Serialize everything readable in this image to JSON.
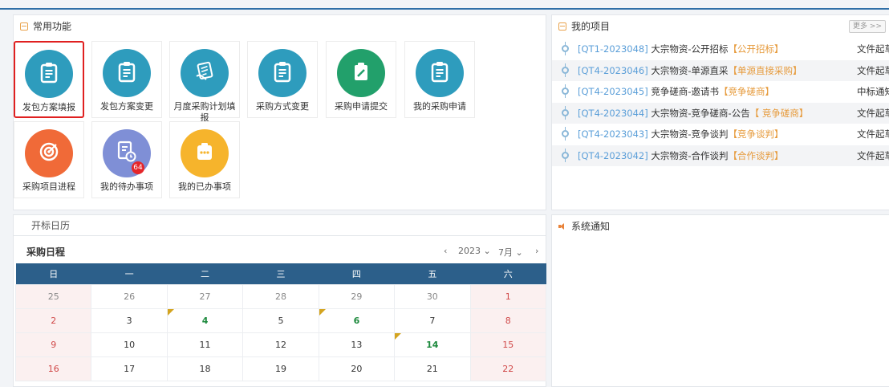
{
  "common": {
    "title": "常用功能",
    "items": [
      {
        "label": "发包方案填报",
        "color": "#2e9cbd",
        "icon": "clipboard-icon",
        "selected": true
      },
      {
        "label": "发包方案变更",
        "color": "#2e9cbd",
        "icon": "clipboard-icon"
      },
      {
        "label": "月度采购计划填报",
        "color": "#2e9cbd",
        "icon": "hand-document-icon"
      },
      {
        "label": "采购方式变更",
        "color": "#2e9cbd",
        "icon": "clipboard-icon"
      },
      {
        "label": "采购申请提交",
        "color": "#22a06b",
        "icon": "clipboard-pen-icon"
      },
      {
        "label": "我的采购申请",
        "color": "#2e9cbd",
        "icon": "clipboard-icon"
      },
      {
        "label": "采购项目进程",
        "color": "#f06a38",
        "icon": "target-icon"
      },
      {
        "label": "我的待办事项",
        "color": "#7f8fd6",
        "icon": "document-clock-icon",
        "badge": "64"
      },
      {
        "label": "我的已办事项",
        "color": "#f6b42c",
        "icon": "clipboard-dots-icon"
      }
    ]
  },
  "projects": {
    "title": "我的项目",
    "more_label": "更多 >>",
    "rows": [
      {
        "code": "[QT1-2023048]",
        "title": "大宗物资-公开招标",
        "tag": "【公开招标】",
        "status": "文件起草"
      },
      {
        "code": "[QT4-2023046]",
        "title": "大宗物资-单源直采",
        "tag": "【单源直接采购】",
        "status": "文件起草"
      },
      {
        "code": "[QT4-2023045]",
        "title": "竞争磋商-邀请书",
        "tag": "【竞争磋商】",
        "status": "中标通知"
      },
      {
        "code": "[QT4-2023044]",
        "title": "大宗物资-竞争磋商-公告",
        "tag": "【 竞争磋商】",
        "status": "文件起草"
      },
      {
        "code": "[QT4-2023043]",
        "title": "大宗物资-竞争谈判",
        "tag": "【竞争谈判】",
        "status": "文件起草"
      },
      {
        "code": "[QT4-2023042]",
        "title": "大宗物资-合作谈判",
        "tag": "【合作谈判】",
        "status": "文件起草"
      }
    ]
  },
  "calendar": {
    "panel_title": "开标日历",
    "title": "采购日程",
    "prev_label": "‹",
    "next_label": "›",
    "year": "2023",
    "month": "7月",
    "weekdays": [
      "日",
      "一",
      "二",
      "三",
      "四",
      "五",
      "六"
    ],
    "weeks": [
      [
        {
          "d": "25",
          "prev": true
        },
        {
          "d": "26",
          "prev": true
        },
        {
          "d": "27",
          "prev": true
        },
        {
          "d": "28",
          "prev": true
        },
        {
          "d": "29",
          "prev": true
        },
        {
          "d": "30",
          "prev": true
        },
        {
          "d": "1"
        }
      ],
      [
        {
          "d": "2"
        },
        {
          "d": "3"
        },
        {
          "d": "4",
          "event": true
        },
        {
          "d": "5"
        },
        {
          "d": "6",
          "event": true
        },
        {
          "d": "7"
        },
        {
          "d": "8"
        }
      ],
      [
        {
          "d": "9"
        },
        {
          "d": "10"
        },
        {
          "d": "11"
        },
        {
          "d": "12"
        },
        {
          "d": "13"
        },
        {
          "d": "14",
          "event": true
        },
        {
          "d": "15"
        }
      ],
      [
        {
          "d": "16"
        },
        {
          "d": "17"
        },
        {
          "d": "18"
        },
        {
          "d": "19"
        },
        {
          "d": "20"
        },
        {
          "d": "21"
        },
        {
          "d": "22"
        }
      ]
    ]
  },
  "notice": {
    "title": "系统通知"
  }
}
